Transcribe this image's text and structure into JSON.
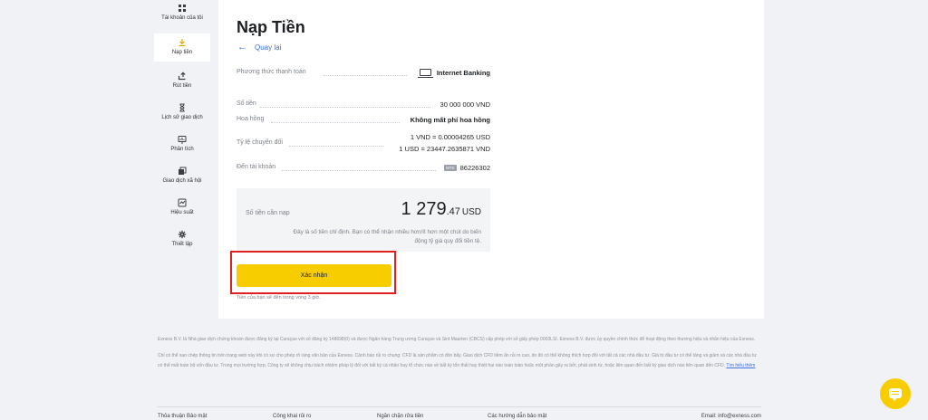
{
  "sidebar": {
    "items": [
      {
        "label": "Tài khoản của tôi",
        "icon": "grid-icon",
        "active": false
      },
      {
        "label": "Nạp tiền",
        "icon": "download-icon",
        "active": true
      },
      {
        "label": "Rút tiền",
        "icon": "upload-icon",
        "active": false
      },
      {
        "label": "Lịch sử giao dịch",
        "icon": "hourglass-icon",
        "active": false
      },
      {
        "label": "Phân tích",
        "icon": "chart-icon",
        "active": false
      },
      {
        "label": "Giao dịch xã hội",
        "icon": "copy-icon",
        "active": false
      },
      {
        "label": "Hiệu suất",
        "icon": "performance-icon",
        "active": false
      },
      {
        "label": "Thiết lập",
        "icon": "gear-icon",
        "active": false
      }
    ]
  },
  "page": {
    "title": "Nạp Tiền",
    "back_label": "Quay lại"
  },
  "details": {
    "payment_method": {
      "label": "Phương thức thanh toán",
      "value": "Internet Banking"
    },
    "amount": {
      "label": "Số tiền",
      "value": "30 000 000 VND"
    },
    "commission": {
      "label": "Hoa hồng",
      "value": "Không mất phí hoa hồng"
    },
    "rate": {
      "label": "Tỷ lệ chuyển đổi",
      "value_1": "1 VND = 0.00004265 USD",
      "value_2": "1 USD = 23447.2635871 VND"
    },
    "to_account": {
      "label": "Đến tài khoản",
      "badge": "MTK",
      "value": "86226302"
    }
  },
  "summary": {
    "label": "Số tiền cần nạp",
    "amount_int": "1 279",
    "amount_dec": ".47",
    "currency": "USD",
    "note": "Đây là số tiền chỉ định. Bạn có thể nhận nhiều hơn/ít hơn một chút do biến động tỷ giá quy đổi tiền tệ."
  },
  "confirm": {
    "button_label": "Xác nhận",
    "note": "Tiền của bạn sẽ đến trong vòng 3 giờ."
  },
  "footer": {
    "para1": "Exness B.V. là Nhà giao dịch chứng khoán được đăng ký tại Curaçao với số đăng ký 148698(0) và được Ngân hàng Trung ương Curaçao và Sint Maarten (CBCS) cấp phép với số giấy phép 0003LSI. Exness B.V. được ủy quyền chính thức để hoạt động theo thương hiệu và nhãn hiệu của Exness.",
    "para2": "Chỉ có thể sao chép thông tin trên trang web này khi có sự cho phép rõ ràng văn bản của Exness. Cảnh báo rủi ro chung: CFD là sản phẩm có đòn bẩy. Giao dịch CFD tiềm ẩn rủi ro cao, do đó có thể không thích hợp đối với tất cả các nhà đầu tư. Giá trị đầu tư có thể tăng và giảm và các nhà đầu tư có thể mất toàn bộ vốn đầu tư. Trong mọi trường hợp, Công ty sẽ không chịu trách nhiệm pháp lý đối với bất kỳ cá nhân hay tổ chức nào về bất kỳ tổn thất hay thiệt hại nào toàn toàn hoặc một phần gây ra bởi, phát sinh từ, hoặc liên quan đến bất kỳ giao dịch nào liên quan đến CFD.",
    "link": "Tìm hiểu thêm",
    "links": [
      "Thỏa thuận Bảo mật",
      "Công khai rủi ro",
      "Ngăn chặn rửa tiền",
      "Các hướng dẫn bảo mật"
    ],
    "email": "Email: info@exness.com"
  },
  "colors": {
    "accent": "#f8cd00",
    "link": "#3f6fe0",
    "highlight_frame": "#e0201f"
  }
}
